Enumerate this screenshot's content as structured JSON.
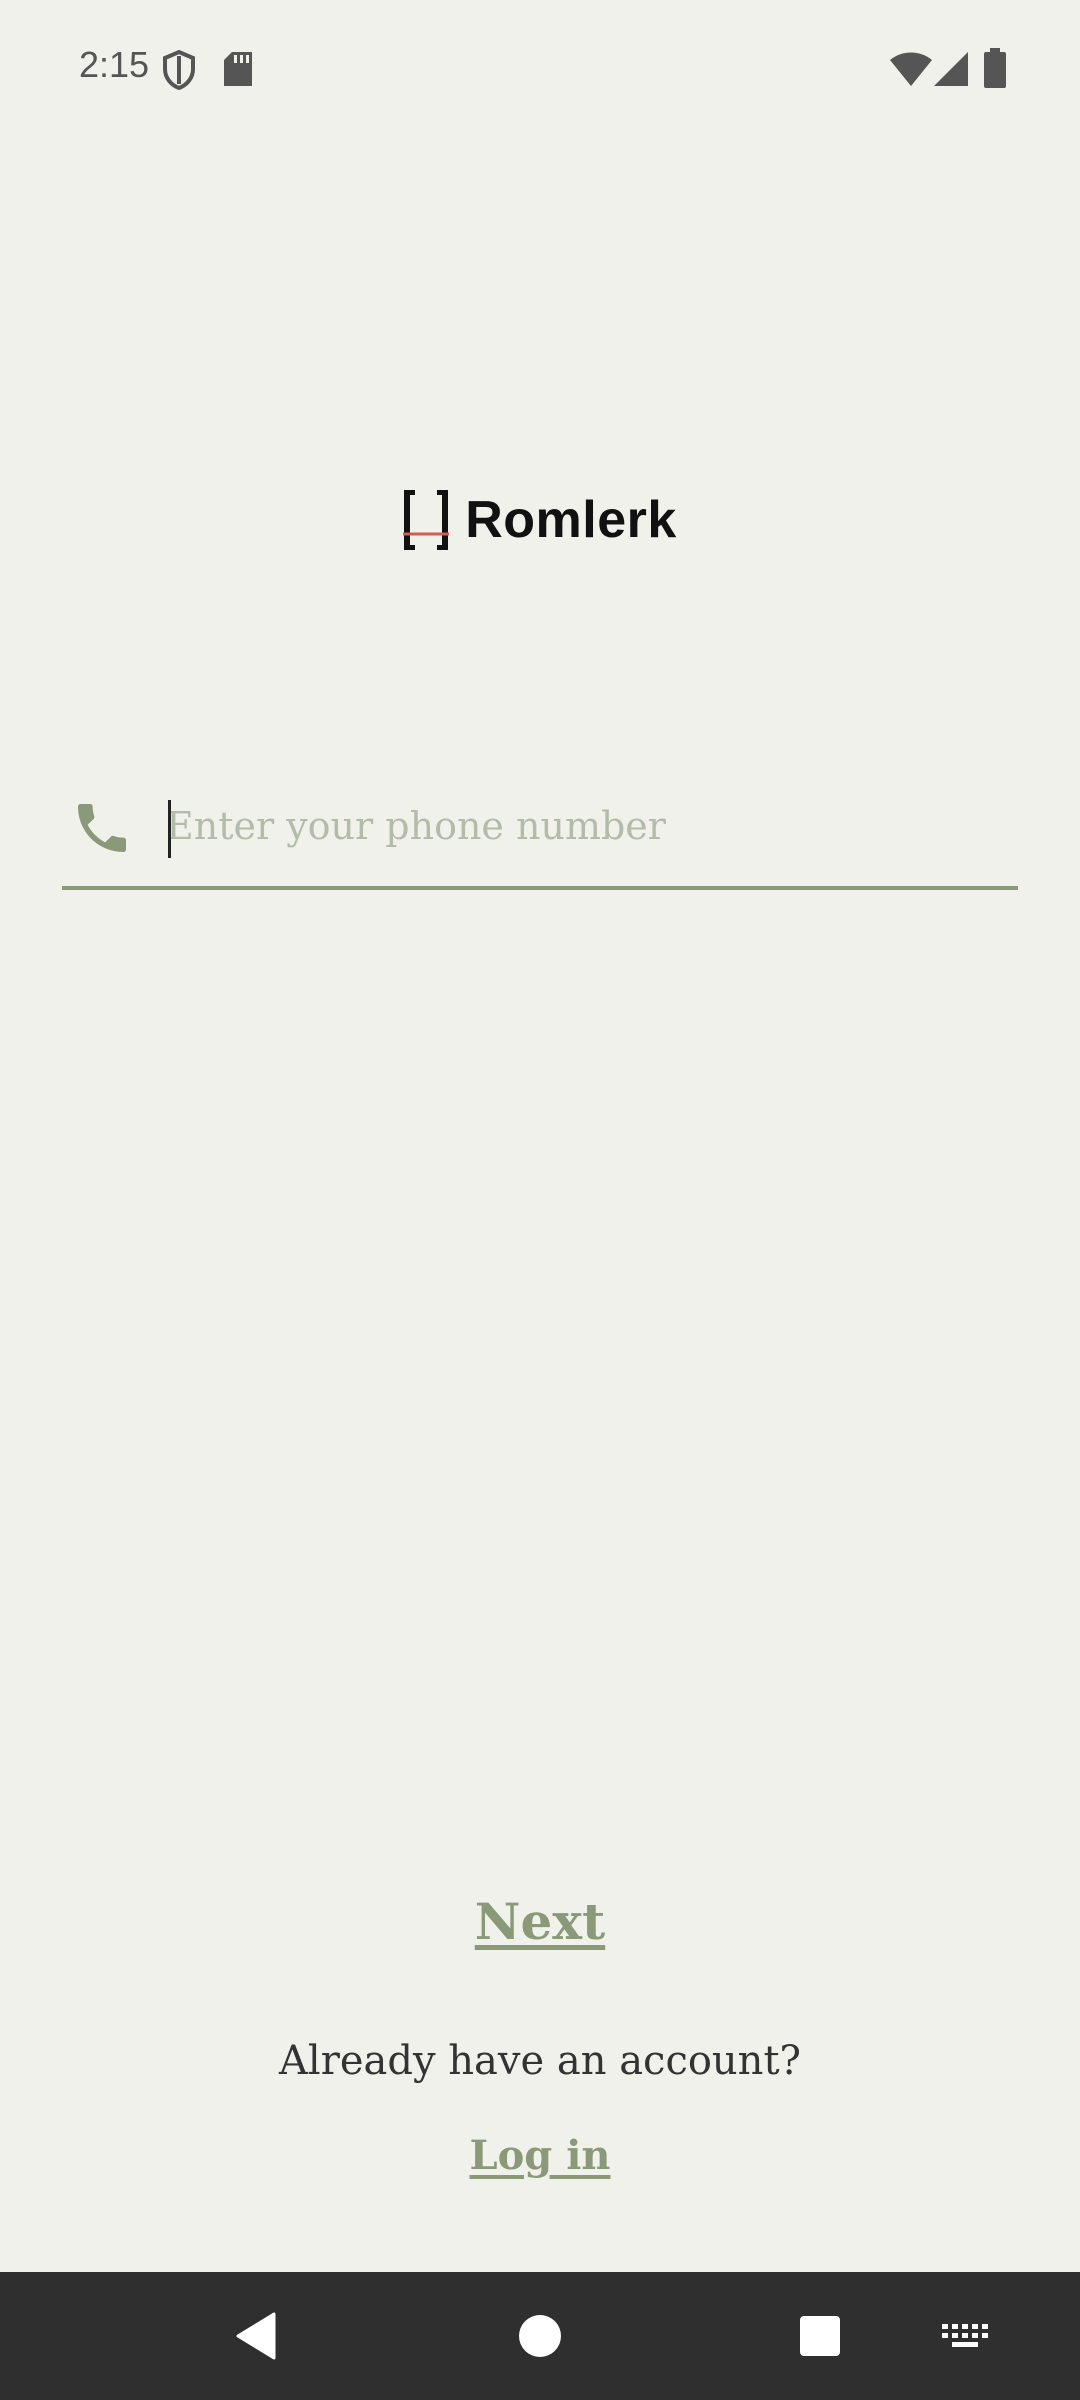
{
  "status_bar": {
    "time": "2:15",
    "icons": [
      "shield-icon",
      "sd-card-icon",
      "wifi-icon",
      "signal-icon",
      "battery-icon"
    ]
  },
  "logo": {
    "text": "Romlerk"
  },
  "phone_field": {
    "icon": "phone-icon",
    "placeholder": "Enter your phone number",
    "value": ""
  },
  "actions": {
    "next_label": "Next",
    "account_prompt": "Already have an account?",
    "login_label": "Log in"
  },
  "nav_bar": {
    "icons": [
      "back-icon",
      "home-icon",
      "recents-icon",
      "keyboard-icon"
    ]
  },
  "colors": {
    "background": "#f1f1ec",
    "accent": "#8a9a78",
    "placeholder": "#b3bca8",
    "nav_background": "#2f2f2f"
  }
}
